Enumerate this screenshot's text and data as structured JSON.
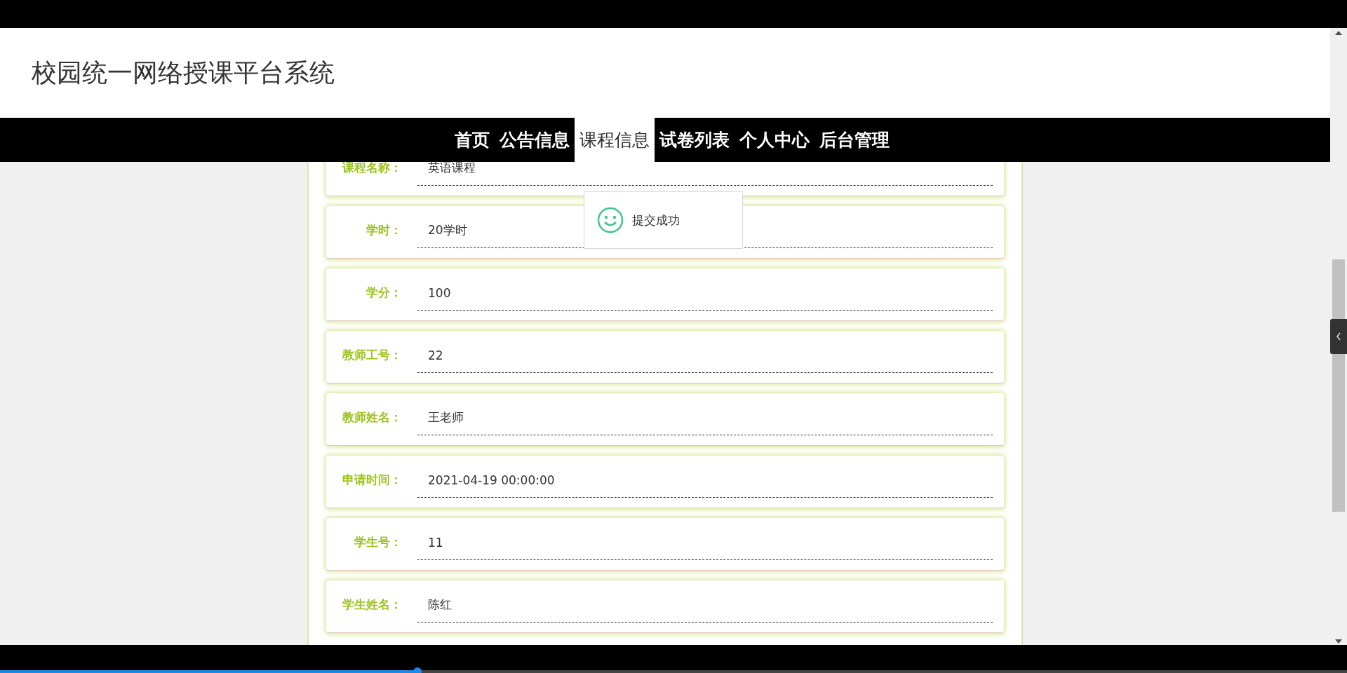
{
  "header": {
    "title": "校园统一网络授课平台系统"
  },
  "nav": [
    {
      "label": "首页",
      "selected": false
    },
    {
      "label": "公告信息",
      "selected": false
    },
    {
      "label": "课程信息",
      "selected": true
    },
    {
      "label": "试卷列表",
      "selected": false
    },
    {
      "label": "个人中心",
      "selected": false
    },
    {
      "label": "后台管理",
      "selected": false
    }
  ],
  "form": {
    "fields": [
      {
        "label": "课程名称：",
        "value": "英语课程"
      },
      {
        "label": "学时：",
        "value": "20学时"
      },
      {
        "label": "学分：",
        "value": "100"
      },
      {
        "label": "教师工号：",
        "value": "22"
      },
      {
        "label": "教师姓名：",
        "value": "王老师"
      },
      {
        "label": "申请时间：",
        "value": "2021-04-19 00:00:00"
      },
      {
        "label": "学生号：",
        "value": "11"
      },
      {
        "label": "学生姓名：",
        "value": "陈红"
      }
    ]
  },
  "toast": {
    "message": "提交成功"
  },
  "video_progress": {
    "level": 0.31
  }
}
